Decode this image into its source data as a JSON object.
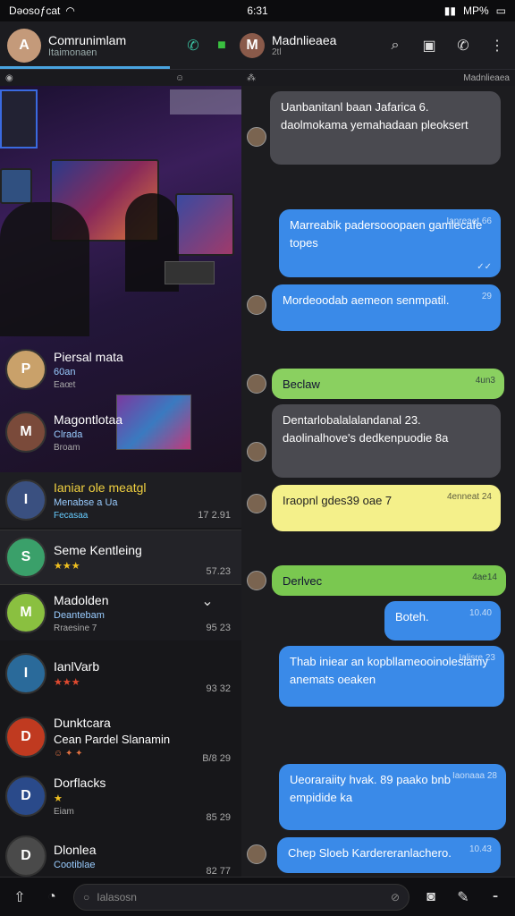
{
  "status": {
    "carrier": "Dəosoƒcat",
    "time": "6:31",
    "right": "MP%"
  },
  "header": {
    "name": "Comrunimlam",
    "sub": "Itaimonaen",
    "contact": "Madnlieaea",
    "contact_sub": "2tl"
  },
  "tabs": {
    "right_label": "Madnlieaea"
  },
  "list": [
    {
      "name": "Piersal mata",
      "preview": "60an",
      "sub": "Eaœt",
      "time": "",
      "color": "#c9a16a"
    },
    {
      "name": "Magontlotaa",
      "preview": "Clrada",
      "sub": "Broam",
      "time": "",
      "color": "#7a4a3a"
    },
    {
      "name": "Ianiar ole meatgl",
      "preview": "Menabse a Ua",
      "sub": "Fecasaa",
      "time": "17 2.91",
      "color": "#3a5080"
    },
    {
      "name": "Seme Kentleing",
      "preview": "★★★",
      "sub": "",
      "time": "57.23",
      "color": "#3aa06a"
    },
    {
      "name": "Madolden",
      "preview": "Deantebam",
      "sub": "Rraesine 7",
      "time": "95 23",
      "color": "#8ac040"
    },
    {
      "name": "IanlVarb",
      "preview": "★★★",
      "sub": "",
      "time": "93 32",
      "color": "#2a6a9a"
    },
    {
      "name": "Dunktcara",
      "preview": "Cean Pardel Slanamin",
      "sub": "",
      "time": "B/8 29",
      "color": "#c03a20"
    },
    {
      "name": "Dorflacks",
      "preview": "★",
      "sub": "Eiam",
      "time": "85 29",
      "color": "#2a4a8a"
    },
    {
      "name": "Dlonlea",
      "preview": "Cootiblae",
      "sub": "",
      "time": "82 77",
      "color": "#4a4a4a"
    }
  ],
  "messages": [
    {
      "text": "Uanbanitanl baan Jafarica 6. daolmokama yemahadaan pleoksert",
      "time": "",
      "kind": "in"
    },
    {
      "text": "Marreabik padersooopaen gamlecafe topes",
      "time": "Ianreaet 66",
      "kind": "out"
    },
    {
      "text": "Mordeoodab aemeon senmpatil.",
      "time": "29",
      "kind": "out"
    },
    {
      "text": "Beclaw",
      "time": "4un3",
      "kind": "green"
    },
    {
      "text": "Dentarlobalalalandanal 23. daolinalhove's dedkenpuodie 8a",
      "time": "",
      "kind": "in"
    },
    {
      "text": "Iraopnl gdes39 oae 7",
      "time": "4enneat 24",
      "kind": "yellow"
    },
    {
      "text": "Derlvec",
      "time": "4ae14",
      "kind": "green"
    },
    {
      "text": "Boteh.",
      "time": "10.40",
      "kind": "out"
    },
    {
      "text": "Thab iniear an kopbllameooinolesiamy anemats oeaken",
      "time": "Ialisre 23",
      "kind": "out"
    },
    {
      "text": "Ueoraraiity hvak. 89 paako bnb empidide ka",
      "time": "Iaonaaa 28",
      "kind": "out"
    },
    {
      "text": "Chep Sloeb Kardereranlachero.",
      "time": "10.43",
      "kind": "out"
    }
  ],
  "input": {
    "placeholder": "Ialasosn"
  }
}
